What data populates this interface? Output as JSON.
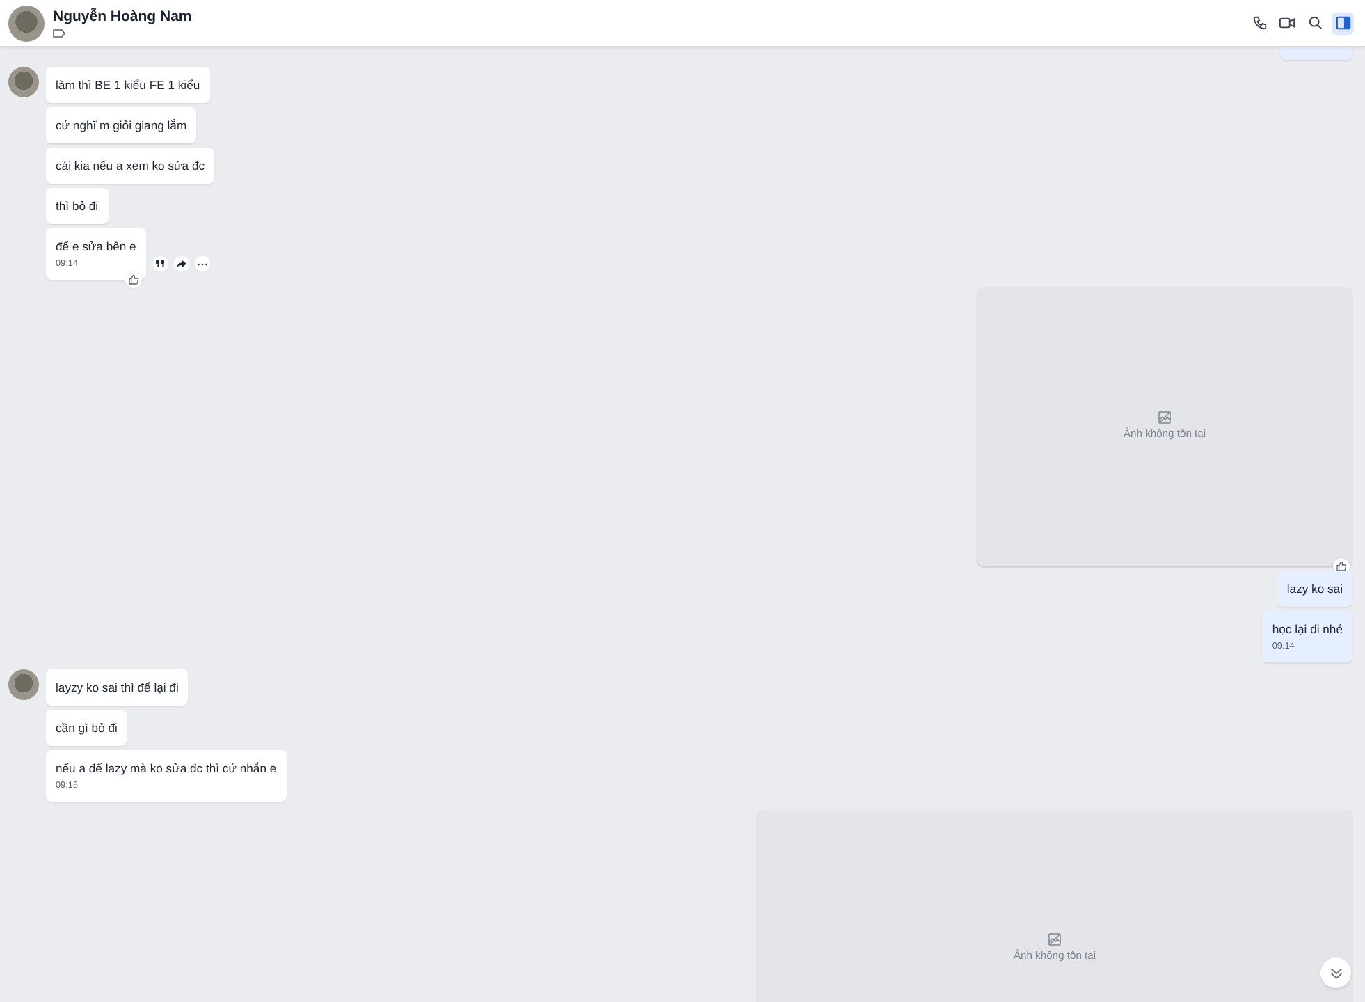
{
  "header": {
    "name": "Nguyễn Hoàng Nam",
    "actions": [
      {
        "kind": "phone",
        "selected": false
      },
      {
        "kind": "video",
        "selected": false
      },
      {
        "kind": "search",
        "selected": false
      },
      {
        "kind": "panel",
        "selected": true
      }
    ]
  },
  "messages": [
    {
      "kind": "stub",
      "outgoing": true
    },
    {
      "kind": "text",
      "outgoing": false,
      "avatar": true,
      "text": "làm thì BE 1 kiểu FE 1 kiểu"
    },
    {
      "kind": "text",
      "outgoing": false,
      "avatar": false,
      "text": "cứ nghĩ m giỏi giang lắm"
    },
    {
      "kind": "text",
      "outgoing": false,
      "avatar": false,
      "text": "cái kia nếu a xem ko sửa đc"
    },
    {
      "kind": "text",
      "outgoing": false,
      "avatar": false,
      "text": "thì bỏ đi"
    },
    {
      "kind": "text",
      "outgoing": false,
      "avatar": false,
      "text": "để e sửa bên e",
      "time": "09:14",
      "liked": true,
      "hovered": true
    },
    {
      "kind": "image",
      "outgoing": true,
      "wide": false,
      "caption": "Ảnh không tồn tại",
      "liked": true
    },
    {
      "kind": "text",
      "outgoing": true,
      "text": "lazy ko sai"
    },
    {
      "kind": "text",
      "outgoing": true,
      "text": "học lại đi nhé",
      "time": "09:14"
    },
    {
      "kind": "text",
      "outgoing": false,
      "avatar": true,
      "text": "layzy ko sai thì để lại đi"
    },
    {
      "kind": "text",
      "outgoing": false,
      "avatar": false,
      "text": "cần gì bỏ đi"
    },
    {
      "kind": "text",
      "outgoing": false,
      "avatar": false,
      "text": "nếu a để lazy mà ko sửa đc thì cứ nhắn e",
      "time": "09:15"
    },
    {
      "kind": "image",
      "outgoing": true,
      "wide": true,
      "caption": "Ảnh không tồn tại"
    }
  ]
}
